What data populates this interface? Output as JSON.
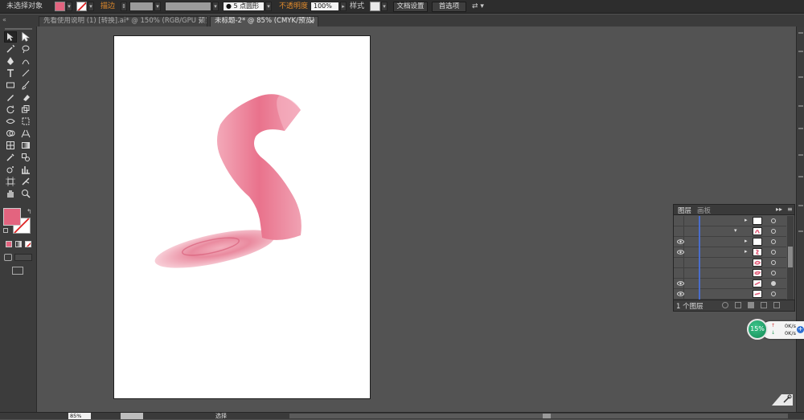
{
  "control_bar": {
    "selection_status": "未选择对象",
    "stroke_label": "描边",
    "stroke_shape_value": "5 点圆形",
    "opacity_label": "不透明度",
    "opacity_value": "100%",
    "style_label": "样式",
    "doc_setup_button": "文档设置",
    "preferences_button": "首选项",
    "fill_color": "#e3647f"
  },
  "tabs": [
    {
      "label": "先看使用说明 (1) [转换].ai* @ 150% (RGB/GPU 预览)",
      "close": "×",
      "active": false
    },
    {
      "label": "未标题-2* @ 85% (CMYK/预览)",
      "close": "×",
      "active": true
    }
  ],
  "tool_panel": {
    "fill_color": "#e3647f",
    "stroke_color": "#ffffff"
  },
  "layers_panel": {
    "tab_layers": "图层",
    "tab_artboards": "画板",
    "layer_count": "1 个图层",
    "rows": [
      {
        "eye": false,
        "arrow": "▸",
        "thumb": "white",
        "circle": "open"
      },
      {
        "eye": false,
        "arrow": "▾",
        "thumb": "snake",
        "circle": "open"
      },
      {
        "eye": true,
        "arrow": "▸",
        "thumb": "white",
        "circle": "open"
      },
      {
        "eye": true,
        "arrow": "▸",
        "thumb": "s-shape",
        "circle": "open"
      },
      {
        "eye": false,
        "arrow": "",
        "thumb": "blob",
        "circle": "open"
      },
      {
        "eye": false,
        "arrow": "",
        "thumb": "blob2",
        "circle": "open"
      },
      {
        "eye": true,
        "arrow": "",
        "thumb": "stroke",
        "circle": "filled"
      },
      {
        "eye": true,
        "arrow": "",
        "thumb": "stroke2",
        "circle": "open"
      }
    ]
  },
  "speed_widget": {
    "percent": "15%",
    "upload": "0K/s",
    "download": "0K/s"
  },
  "status_bar": {
    "zoom": "85%",
    "state": "选择"
  },
  "colors": {
    "accent_pink": "#e3647f",
    "panel_dark": "#3c3c3c",
    "canvas_bg": "#535353",
    "layer_line": "#4a6dcb"
  }
}
